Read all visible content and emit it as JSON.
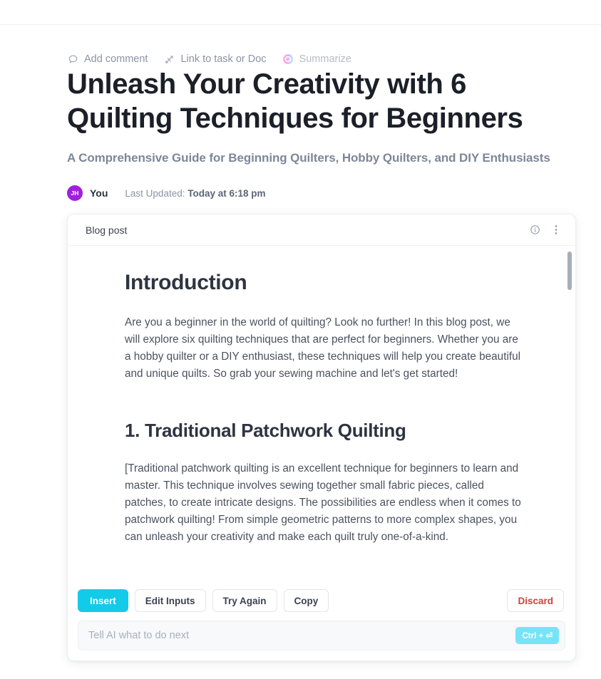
{
  "doc_actions": [
    {
      "label": "Add comment",
      "icon": "comment-icon",
      "muted": false
    },
    {
      "label": "Link to task or Doc",
      "icon": "link-arrow-icon",
      "muted": false
    },
    {
      "label": "Summarize",
      "icon": "ai-sparkle-icon",
      "muted": true
    }
  ],
  "document": {
    "title": "Unleash Your Creativity with 6 Quilting Techniques for Beginners",
    "subtitle": "A Comprehensive Guide for Beginning Quilters, Hobby Quilters, and DIY Enthusiasts"
  },
  "byline": {
    "avatar_initials": "JH",
    "author": "You",
    "updated_prefix": "Last Updated:",
    "updated_value": "Today at 6:18 pm"
  },
  "ai_card": {
    "header": {
      "title": "Blog post",
      "icon": "ai-sparkle-icon",
      "info_icon": "info-circle-icon",
      "menu_icon": "kebab-menu-icon"
    },
    "content": {
      "heading_1": "Introduction",
      "paragraph_1": "Are you a beginner in the world of quilting? Look no further! In this blog post, we will explore six quilting techniques that are perfect for beginners. Whether you are a hobby quilter or a DIY enthusiast, these techniques will help you create beautiful and unique quilts. So grab your sewing machine and let's get started!",
      "heading_2": "1. Traditional Patchwork Quilting",
      "paragraph_2": "[Traditional patchwork quilting is an excellent technique for beginners to learn and master. This technique involves sewing together small fabric pieces, called patches, to create intricate designs. The possibilities are endless when it comes to patchwork quilting! From simple geometric patterns to more complex shapes, you can unleash your creativity and make each quilt truly one-of-a-kind."
    },
    "actions": {
      "insert": "Insert",
      "edit_inputs": "Edit Inputs",
      "try_again": "Try Again",
      "copy": "Copy",
      "discard": "Discard"
    },
    "prompt": {
      "placeholder": "Tell AI what to do next",
      "value": "",
      "shortcut_badge": "Ctrl + ⏎"
    }
  },
  "colors": {
    "accent_cyan": "#12cbe8",
    "badge_cyan": "#76e4f7",
    "danger_red": "#d0423a",
    "avatar_purple": "#a020dd",
    "text_dark": "#2e3440",
    "text_muted": "#8a94a6"
  }
}
